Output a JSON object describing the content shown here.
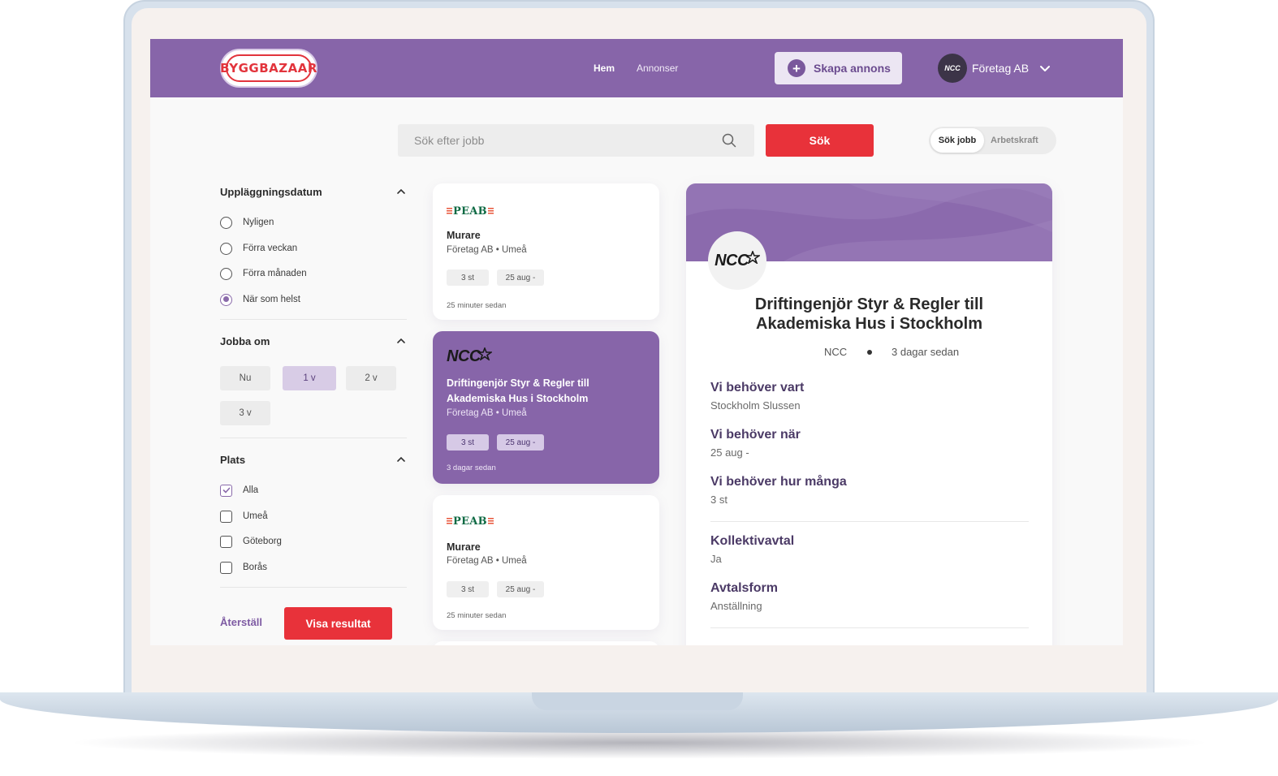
{
  "brand": {
    "logo_text": "BYGGBAZAAR",
    "accent": "#8765a9",
    "red": "#e8323a"
  },
  "nav": {
    "home": "Hem",
    "ads": "Annonser",
    "create_button": "Skapa annons",
    "user_name": "Företag AB",
    "user_avatar_text": "NCC"
  },
  "search": {
    "placeholder": "Sök efter jobb",
    "button": "Sök",
    "toggle_active": "Sök jobb",
    "toggle_other": "Arbetskraft"
  },
  "filters": {
    "date": {
      "title": "Uppläggningsdatum",
      "options": [
        "Nyligen",
        "Förra veckan",
        "Förra månaden",
        "När som helst"
      ],
      "selected": "När som helst"
    },
    "work_in": {
      "title": "Jobba om",
      "chips": [
        "Nu",
        "1 v",
        "2 v",
        "3 v"
      ],
      "selected": "1 v"
    },
    "place": {
      "title": "Plats",
      "options": [
        "Alla",
        "Umeå",
        "Göteborg",
        "Borås"
      ],
      "checked": [
        "Alla"
      ]
    },
    "reset": "Återställ",
    "show_results": "Visa resultat"
  },
  "cards": [
    {
      "logo": "PEAB",
      "title": "Murare",
      "subtitle": "Företag AB • Umeå",
      "qty": "3 st",
      "date": "25 aug -",
      "time": "25 minuter sedan",
      "active": false
    },
    {
      "logo": "NCC",
      "title": "Driftingenjör Styr & Regler till Akademiska Hus i Stockholm",
      "subtitle": "Företag AB • Umeå",
      "qty": "3 st",
      "date": "25 aug -",
      "time": "3 dagar sedan",
      "active": true
    },
    {
      "logo": "PEAB",
      "title": "Murare",
      "subtitle": "Företag AB • Umeå",
      "qty": "3 st",
      "date": "25 aug -",
      "time": "25 minuter sedan",
      "active": false
    }
  ],
  "detail": {
    "logo": "NCC",
    "title_line1": "Driftingenjör Styr & Regler till",
    "title_line2": "Akademiska Hus i Stockholm",
    "company": "NCC",
    "posted": "3 dagar sedan",
    "fields": [
      {
        "label": "Vi behöver vart",
        "value": "Stockholm Slussen"
      },
      {
        "label": "Vi behöver när",
        "value": "25 aug -"
      },
      {
        "label": "Vi behöver hur många",
        "value": "3 st"
      },
      {
        "label": "Kollektivavtal",
        "value": "Ja"
      },
      {
        "label": "Avtalsform",
        "value": "Anställning"
      }
    ]
  }
}
